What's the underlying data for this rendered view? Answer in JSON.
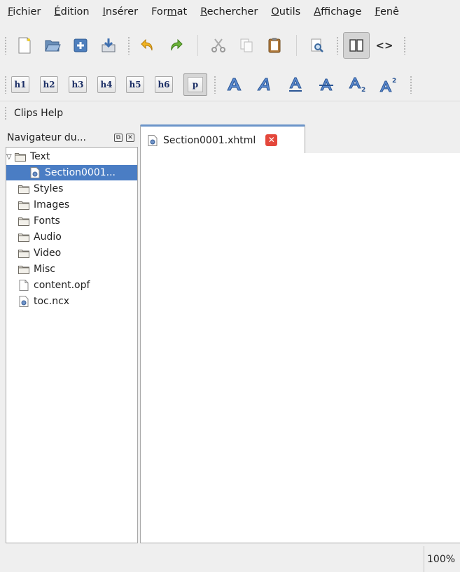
{
  "menubar": {
    "items": [
      {
        "mnemonic": "F",
        "rest": "ichier"
      },
      {
        "mnemonic": "É",
        "rest": "dition"
      },
      {
        "mnemonic": "I",
        "rest": "nsérer"
      },
      {
        "pre": "For",
        "mnemonic": "m",
        "rest": "at"
      },
      {
        "mnemonic": "R",
        "rest": "echercher"
      },
      {
        "mnemonic": "O",
        "rest": "utils"
      },
      {
        "mnemonic": "A",
        "rest": "ffichage"
      },
      {
        "mnemonic": "F",
        "rest": "enê"
      }
    ]
  },
  "toolbar": {
    "headings": [
      "h1",
      "h2",
      "h3",
      "h4",
      "h5",
      "h6"
    ],
    "paragraph": "p",
    "code_view_glyph": "<>"
  },
  "clips": {
    "label": "Clips Help"
  },
  "navigator": {
    "title": "Navigateur du...",
    "tree": [
      {
        "label": "Text",
        "type": "folder",
        "expanded": true
      },
      {
        "label": "Section0001...",
        "type": "xhtml",
        "selected": true
      },
      {
        "label": "Styles",
        "type": "folder"
      },
      {
        "label": "Images",
        "type": "folder"
      },
      {
        "label": "Fonts",
        "type": "folder"
      },
      {
        "label": "Audio",
        "type": "folder"
      },
      {
        "label": "Video",
        "type": "folder"
      },
      {
        "label": "Misc",
        "type": "folder"
      },
      {
        "label": "content.opf",
        "type": "file"
      },
      {
        "label": "toc.ncx",
        "type": "xhtml"
      }
    ]
  },
  "editor": {
    "tabs": [
      {
        "label": "Section0001.xhtml",
        "active": true
      }
    ]
  },
  "status": {
    "zoom": "100%"
  },
  "colors": {
    "selection": "#4a7dc4",
    "tab_accent": "#6b94c9",
    "close_red": "#e4473b"
  }
}
